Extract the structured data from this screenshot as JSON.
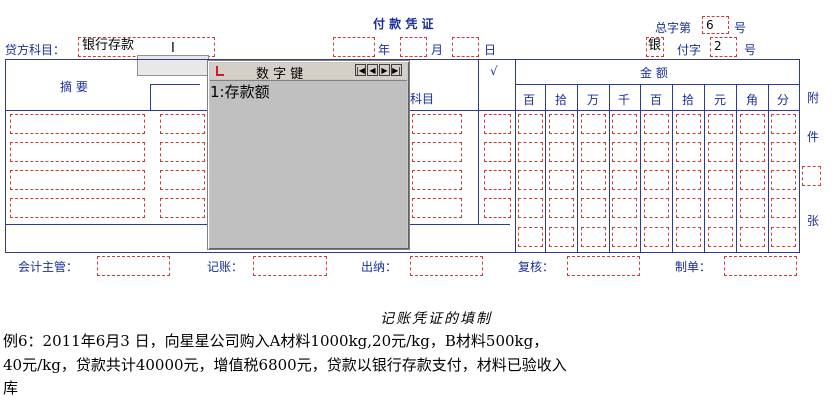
{
  "voucher": {
    "title": "付 款 凭 证",
    "total_no_label": "总字第",
    "total_no_value": "6",
    "hao_label": "号",
    "credit_account_label": "贷方科目：",
    "credit_account_value": "银行存款",
    "year_label": "年",
    "month_label": "月",
    "day_label": "日",
    "voucher_type_value": "银",
    "fu_label": "付字",
    "fu_no_value": "2",
    "fu_hao_label": "号",
    "col_summary": "摘 要",
    "col_check": "√",
    "col_account": "科目",
    "col_amount": "金 额",
    "digits": [
      "百",
      "拾",
      "万",
      "千",
      "百",
      "拾",
      "元",
      "角",
      "分"
    ],
    "attach_labels": [
      "附",
      "件",
      "张"
    ],
    "footer": {
      "supervisor": "会计主管：",
      "bookkeeper": "记账：",
      "cashier": "出纳：",
      "reviewer": "复核：",
      "preparer": "制单："
    }
  },
  "popup": {
    "title": "数 字 键",
    "item": "1:存款额"
  },
  "lesson": {
    "heading": "记账凭证的填制",
    "line1": "例6：2011年6月3 日，向星星公司购入A材料1000kg,20元/kg，B材料500kg，",
    "line2": "40元/kg，贷款共计40000元，增值税6800元，贷款以银行存款支付，材料已验收入",
    "line3": "库"
  },
  "colors": {
    "grid": "#2a3aa0",
    "label": "#1a2f9a",
    "field_border": "#d23a3a",
    "popup_bg": "#c0c0c0"
  }
}
